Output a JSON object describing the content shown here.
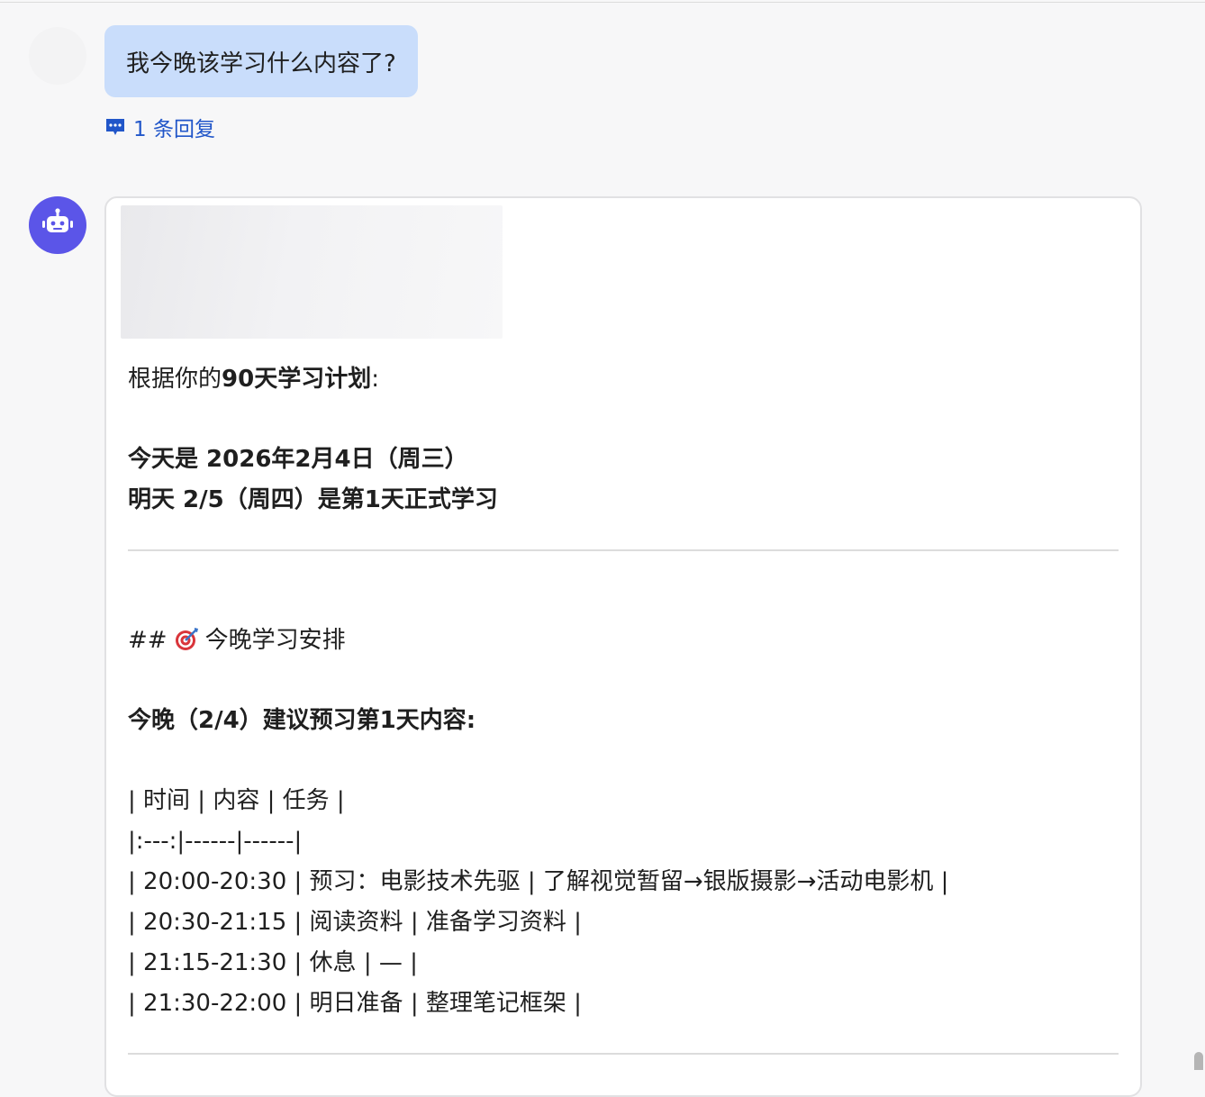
{
  "user_message": {
    "text": "我今晚该学习什么内容了?"
  },
  "thread": {
    "reply_count_label": "1 条回复"
  },
  "bot_message": {
    "intro_prefix": "根据你的",
    "intro_bold": "90天学习计划",
    "intro_suffix": ":",
    "today_line": "今天是 2026年2月4日（周三）",
    "tomorrow_line": "明天 2/5（周四）是第1天正式学习",
    "section_prefix": "##",
    "section_title": "今晚学习安排",
    "suggestion_line": "今晚（2/4）建议预习第1天内容:",
    "table_lines": [
      "| 时间 | 内容 | 任务 |",
      "|:---:|------|------|",
      "| 20:00-20:30 | 预习：电影技术先驱 | 了解视觉暂留→银版摄影→活动电影机 |",
      "| 20:30-21:15 | 阅读资料 | 准备学习资料 |",
      "| 21:15-21:30 | 休息 | — |",
      "| 21:30-22:00 | 明日准备 | 整理笔记框架 |"
    ]
  },
  "icons": {
    "reply": "comment-bubble-icon",
    "bot": "robot-icon",
    "section": "target-dart-icon"
  },
  "colors": {
    "user_bubble": "#c9ddfb",
    "link": "#2156c9",
    "bot_avatar": "#5b55e8"
  }
}
